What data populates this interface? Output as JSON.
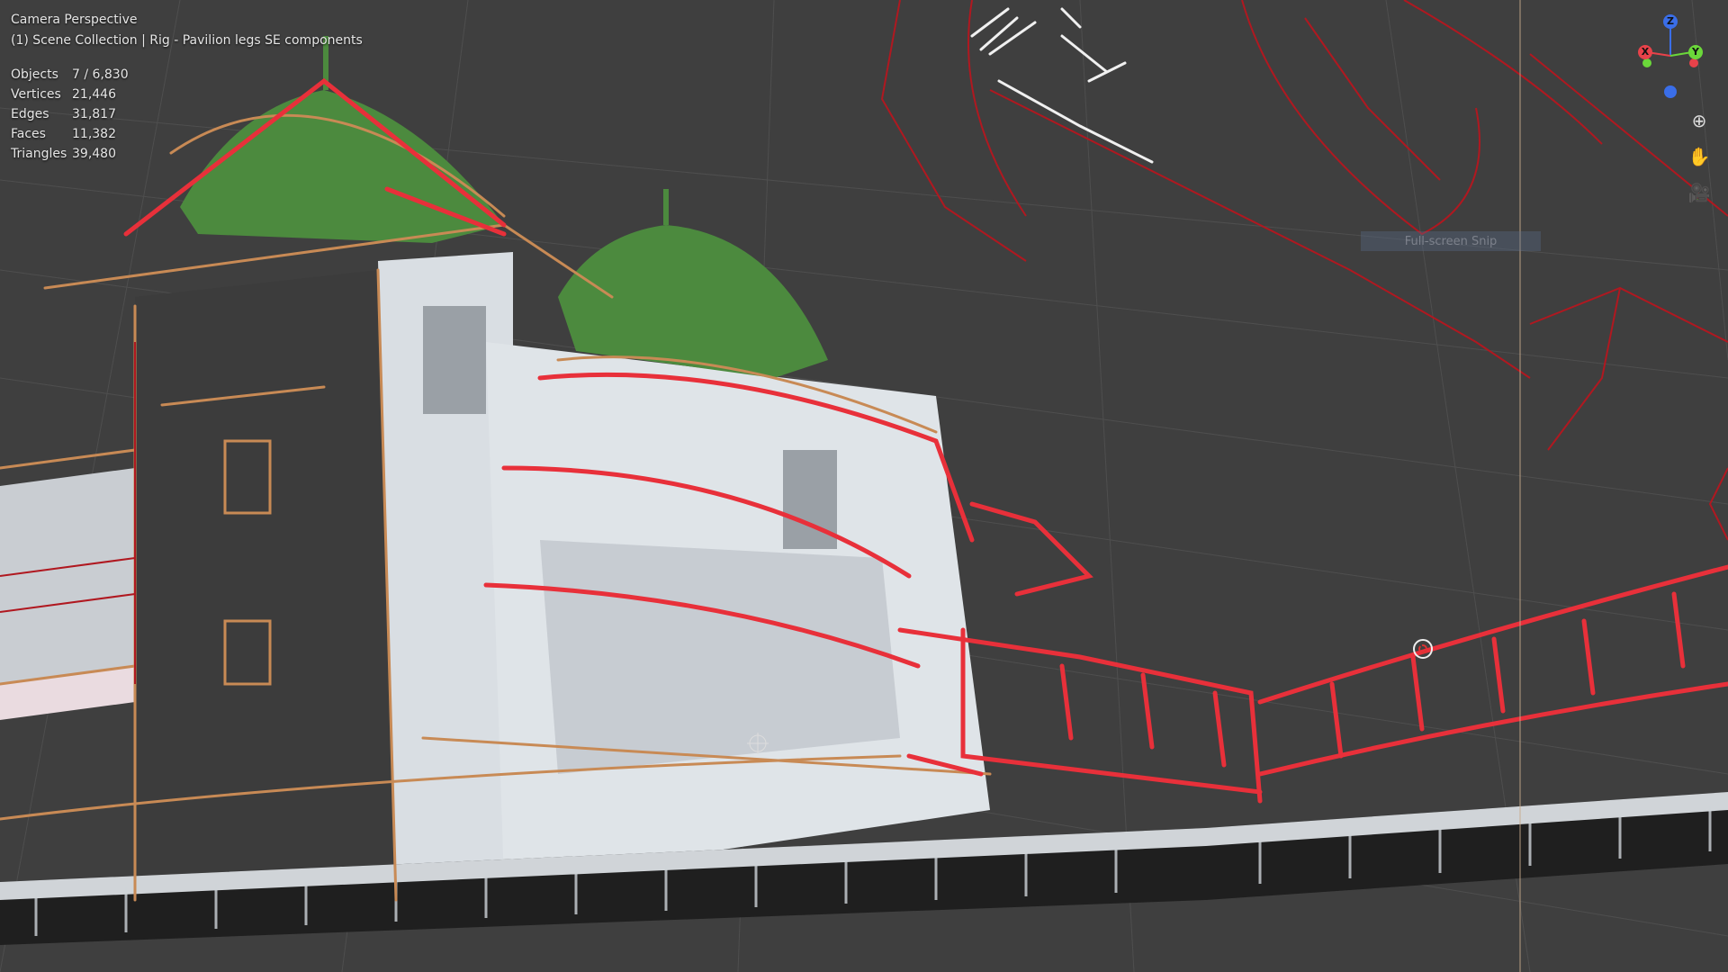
{
  "viewport": {
    "view_title": "Camera Perspective",
    "collection_line": "(1) Scene Collection | Rig - Pavilion legs SE components"
  },
  "stats": [
    {
      "label": "Objects",
      "value": "7 / 6,830"
    },
    {
      "label": "Vertices",
      "value": "21,446"
    },
    {
      "label": "Edges",
      "value": "31,817"
    },
    {
      "label": "Faces",
      "value": "11,382"
    },
    {
      "label": "Triangles",
      "value": "39,480"
    }
  ],
  "gizmo": {
    "z_label": "Z",
    "x_label": "X",
    "y_label": "Y"
  },
  "nav_tools": [
    {
      "icon": "zoom-icon",
      "glyph": "⊕"
    },
    {
      "icon": "pan-hand-icon",
      "glyph": "✋"
    },
    {
      "icon": "camera-view-icon",
      "glyph": "🎥"
    }
  ],
  "tooltip": "Full-screen Snip",
  "colors": {
    "background": "#3f3f3f",
    "grid": "#555555",
    "stroke_red": "#e8303a",
    "stroke_darkred": "#b01820",
    "stroke_orange": "#c88a55",
    "roof_green": "#4c8a3e",
    "building_white": "#d8dde2",
    "axis_x": "#e8424a",
    "axis_y": "#6bd83a",
    "axis_z": "#3a6ee8"
  }
}
